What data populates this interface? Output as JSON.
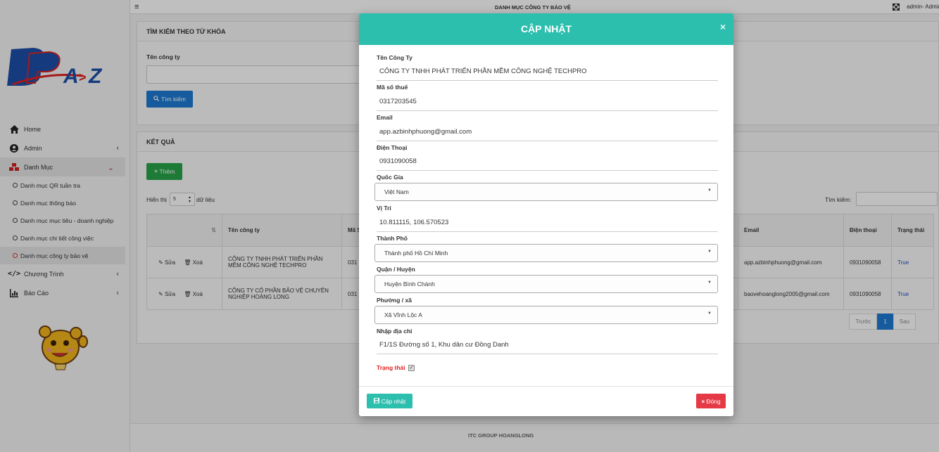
{
  "header": {
    "title": "DANH MỤC CÔNG TY BẢO VỆ",
    "user": "admin- Admin"
  },
  "sidebar": {
    "items": [
      {
        "label": "Home",
        "icon": "home-icon"
      },
      {
        "label": "Admin",
        "icon": "user-circle-icon"
      },
      {
        "label": "Danh Mục",
        "icon": "cubes-icon"
      },
      {
        "label": "Chương Trình",
        "icon": "code-icon"
      },
      {
        "label": "Báo Cáo",
        "icon": "chart-icon"
      }
    ],
    "subitems": [
      {
        "label": "Danh mục QR tuần tra"
      },
      {
        "label": "Danh mục thông báo"
      },
      {
        "label": "Danh mục mục tiêu - doanh nghiệp"
      },
      {
        "label": "Danh mục chi tiết công việc"
      },
      {
        "label": "Danh mục công ty bảo vệ"
      }
    ]
  },
  "search": {
    "title": "TÌM KIẾM THEO TỪ KHÓA",
    "company_label": "Tên công ty",
    "button": "Tìm kiếm"
  },
  "results": {
    "title": "KẾT QUẢ",
    "add_button": "Thêm",
    "show_prefix": "Hiển thị",
    "page_size": "5",
    "show_suffix": "dữ liệu",
    "search_label": "Tìm kiếm:",
    "columns": [
      "Tên công ty",
      "Mã S Thuế",
      "Email",
      "Điện thoại",
      "Trạng thái"
    ],
    "rows": [
      {
        "edit": "Sửa",
        "delete": "Xoá",
        "name": "CÔNG TY TNHH PHÁT TRIỂN PHẦN MỀM CÔNG NGHỆ TECHPRO",
        "tax": "031",
        "email": "app.azbinhphuong@gmail.com",
        "phone": "0931090058",
        "status": "True"
      },
      {
        "edit": "Sửa",
        "delete": "Xoá",
        "name": "CÔNG TY CỔ PHẦN BẢO VỆ CHUYÊN NGHIỆP HOÀNG LONG",
        "tax": "031",
        "email": "baovehoanglong2005@gmail.com",
        "phone": "0931090058",
        "status": "True"
      }
    ],
    "pager": {
      "prev": "Trước",
      "current": "1",
      "next": "Sau"
    }
  },
  "footer": {
    "text": "ITC GROUP HOANGLONG"
  },
  "modal": {
    "title": "CẬP NHẬT",
    "close": "×",
    "fields": {
      "company_label": "Tên Công Ty",
      "company_value": "CÔNG TY TNHH PHÁT TRIỂN PHẦN MỀM CÔNG NGHỆ TECHPRO",
      "tax_label": "Mã số thuế",
      "tax_value": "0317203545",
      "email_label": "Email",
      "email_value": "app.azbinhphuong@gmail.com",
      "phone_label": "Điện Thoại",
      "phone_value": "0931090058",
      "country_label": "Quốc Gia",
      "country_value": "Việt Nam",
      "location_label": "Vị Trí",
      "location_value": "10.811115, 106.570523",
      "city_label": "Thành Phố",
      "city_value": "Thành phố Hồ Chí Minh",
      "district_label": "Quận / Huyện",
      "district_value": "Huyện Bình Chánh",
      "ward_label": "Phường / xã",
      "ward_value": "Xã Vĩnh Lộc A",
      "address_label": "Nhập địa chỉ",
      "address_value": "F1/1S Đường số 1, Khu dân cư Đồng Danh",
      "status_label": "Trạng thái",
      "status_checked": true
    },
    "update_button": "Cập nhật",
    "close_button": "Đóng"
  },
  "colors": {
    "teal": "#2cbfae",
    "blue": "#1e7ad2",
    "green": "#28a34a",
    "red": "#e63946"
  }
}
